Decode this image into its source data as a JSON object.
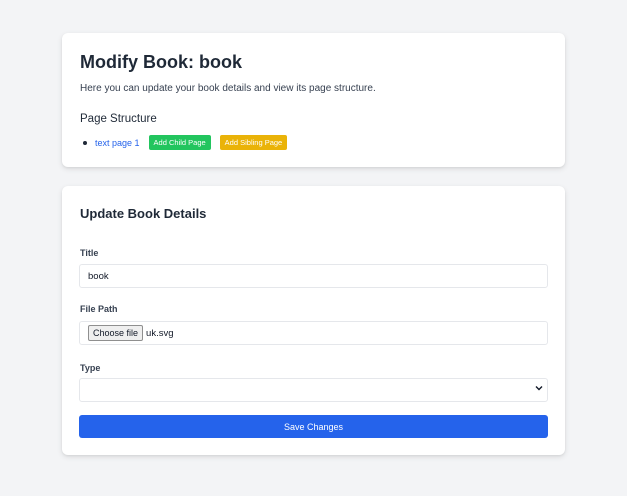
{
  "header": {
    "title": "Modify Book: book",
    "description": "Here you can update your book details and view its page structure.",
    "structure_heading": "Page Structure",
    "pages": [
      {
        "label": "text page 1",
        "add_child": "Add Child Page",
        "add_sibling": "Add Sibling Page"
      }
    ]
  },
  "form": {
    "heading": "Update Book Details",
    "title_label": "Title",
    "title_value": "book",
    "file_label": "File Path",
    "file_button": "Choose file",
    "file_value": "uk.svg",
    "type_label": "Type",
    "type_value": "",
    "save_label": "Save Changes"
  },
  "colors": {
    "accent": "#2563eb",
    "green": "#22c55e",
    "yellow": "#eab308"
  }
}
